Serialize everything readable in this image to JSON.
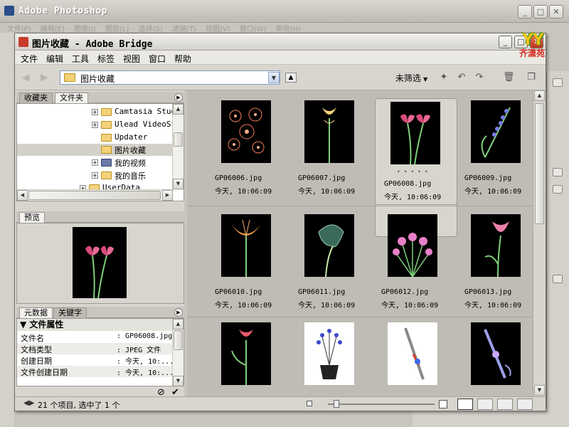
{
  "photoshop": {
    "title": "Adobe Photoshop",
    "menu": [
      "文件(F)",
      "编辑(E)",
      "图像(I)",
      "图层(L)",
      "选择(S)",
      "滤镜(T)",
      "视图(V)",
      "窗口(W)",
      "帮助(H)"
    ]
  },
  "logo": {
    "mark": "YY",
    "text": "齐潇苑"
  },
  "bridge": {
    "title": "图片收藏 - Adobe Bridge",
    "menu": [
      "文件",
      "编辑",
      "工具",
      "标签",
      "视图",
      "窗口",
      "帮助"
    ],
    "toolbar": {
      "path": "图片收藏",
      "filter_label": "未筛选"
    },
    "left": {
      "tabs_top": [
        "收藏夹",
        "文件夹"
      ],
      "tree": [
        {
          "label": "Camtasia Studio",
          "expander": "+",
          "icon": "folder"
        },
        {
          "label": "Ulead VideoStudio",
          "expander": "+",
          "icon": "folder"
        },
        {
          "label": "Updater",
          "expander": "",
          "icon": "folder"
        },
        {
          "label": "图片收藏",
          "expander": "",
          "icon": "folder",
          "selected": true
        },
        {
          "label": "我的视频",
          "expander": "+",
          "icon": "video"
        },
        {
          "label": "我的音乐",
          "expander": "+",
          "icon": "music"
        },
        {
          "label": "UserData",
          "expander": "+",
          "icon": "folder"
        }
      ],
      "preview_tab": "预览",
      "meta_tabs": [
        "元数据",
        "关键字"
      ],
      "meta_section": "文件属性",
      "meta_rows": [
        {
          "key": "文件名",
          "value": "GP06008.jpg"
        },
        {
          "key": "文档类型",
          "value": "JPEG 文件"
        },
        {
          "key": "创建日期",
          "value": "今天, 10:..."
        },
        {
          "key": "文件创建日期",
          "value": "今天, 10:..."
        }
      ]
    },
    "thumbnails": [
      {
        "name": "GP06006.jpg",
        "date": "今天, 10:06:09",
        "style": "dark"
      },
      {
        "name": "GP06007.jpg",
        "date": "今天, 10:06:09",
        "style": "dark"
      },
      {
        "name": "GP06008.jpg",
        "date": "今天, 10:06:09",
        "style": "dark",
        "selected": true
      },
      {
        "name": "GP06009.jpg",
        "date": "今天, 10:06:09",
        "style": "dark"
      },
      {
        "name": "GP06010.jpg",
        "date": "今天, 10:06:09",
        "style": "dark"
      },
      {
        "name": "GP06011.jpg",
        "date": "今天, 10:06:09",
        "style": "dark"
      },
      {
        "name": "GP06012.jpg",
        "date": "今天, 10:06:09",
        "style": "dark"
      },
      {
        "name": "GP06013.jpg",
        "date": "今天, 10:06:09",
        "style": "dark"
      },
      {
        "name": "",
        "date": "",
        "style": "dark"
      },
      {
        "name": "",
        "date": "",
        "style": "white"
      },
      {
        "name": "",
        "date": "",
        "style": "white"
      },
      {
        "name": "",
        "date": "",
        "style": "dark"
      }
    ],
    "status": "21 个项目, 选中了 1 个"
  },
  "colors": {
    "grid_bg": "#bfbcb5",
    "selected_cell": "#d8d5ce",
    "close_button": "#c0351c"
  }
}
